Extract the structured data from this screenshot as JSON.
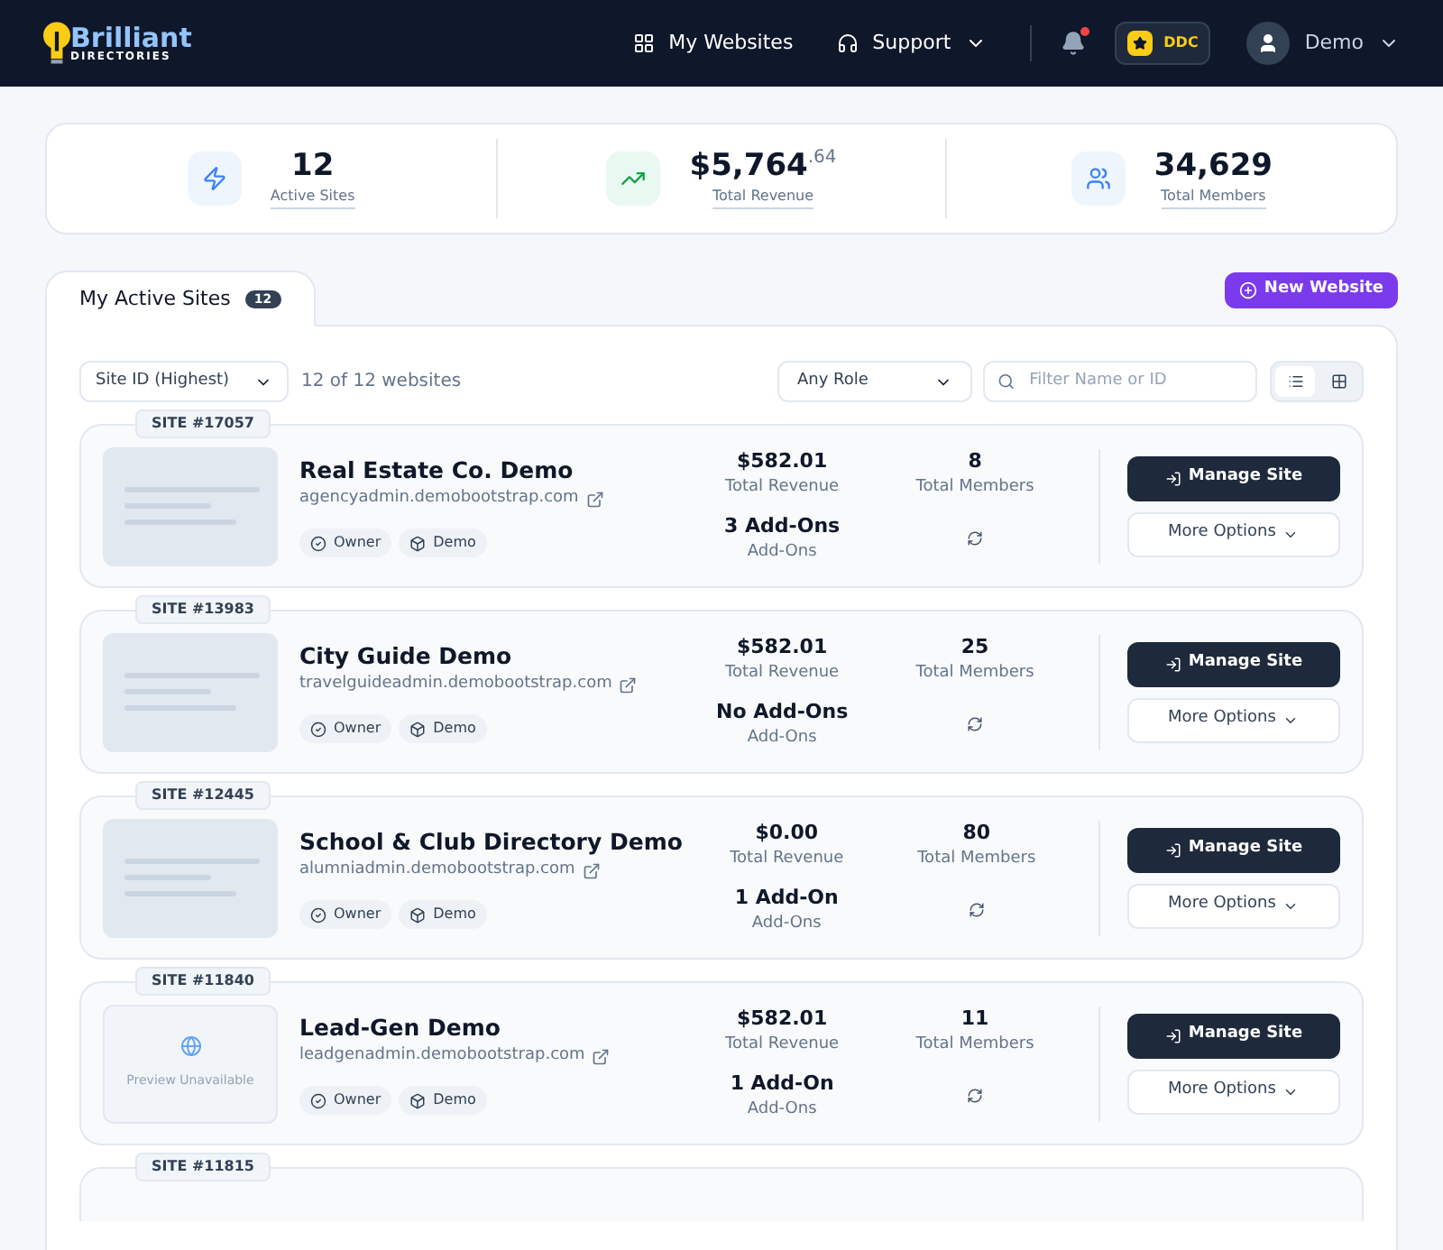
{
  "header": {
    "logo_top": "Brilliant",
    "logo_bottom": "DIRECTORIES",
    "nav": [
      {
        "label": "My Websites",
        "kind": "grid"
      },
      {
        "label": "Support",
        "kind": "support"
      }
    ],
    "notification_dot": true,
    "badge": "DDC",
    "user": "Demo"
  },
  "stats": [
    {
      "value": "12",
      "label": "Active Sites",
      "kind": "bolt"
    },
    {
      "value": "$5,764",
      "cents": ".64",
      "label": "Total Revenue",
      "kind": "chart"
    },
    {
      "value": "34,629",
      "label": "Total Members",
      "kind": "users"
    }
  ],
  "tab": {
    "label": "My Active Sites",
    "count": "12",
    "selected": true
  },
  "new_button": "New Website",
  "filters": {
    "sort": "Site ID (Highest)",
    "count_text": "12 of 12 websites",
    "role": "Any Role",
    "search_placeholder": "Filter Name or ID",
    "views": [
      {
        "kind": "list",
        "selected": true
      },
      {
        "kind": "grid",
        "selected": false
      }
    ]
  },
  "sites": [
    {
      "id": "SITE #17057",
      "name": "Real Estate Co. Demo",
      "domain": "agencyadmin.demobootstrap.com",
      "revenue": "$582.01",
      "revenue_label": "Total Revenue",
      "members": "8",
      "members_label": "Total Members",
      "addons": "3 Add-Ons",
      "addons_label": "Add-Ons",
      "preview": {
        "kind": "image"
      },
      "tags": [
        "Owner",
        "Demo"
      ],
      "manage": "Manage Site",
      "more": "More Options"
    },
    {
      "id": "SITE #13983",
      "name": "City Guide Demo",
      "domain": "travelguideadmin.demobootstrap.com",
      "revenue": "$582.01",
      "revenue_label": "Total Revenue",
      "members": "25",
      "members_label": "Total Members",
      "addons": "No Add-Ons",
      "addons_label": "Add-Ons",
      "preview": {
        "kind": "image"
      },
      "tags": [
        "Owner",
        "Demo"
      ],
      "manage": "Manage Site",
      "more": "More Options"
    },
    {
      "id": "SITE #12445",
      "name": "School & Club Directory Demo",
      "domain": "alumniadmin.demobootstrap.com",
      "revenue": "$0.00",
      "revenue_label": "Total Revenue",
      "members": "80",
      "members_label": "Total Members",
      "addons": "1 Add-On",
      "addons_label": "Add-Ons",
      "preview": {
        "kind": "image"
      },
      "tags": [
        "Owner",
        "Demo"
      ],
      "manage": "Manage Site",
      "more": "More Options"
    },
    {
      "id": "SITE #11840",
      "name": "Lead-Gen Demo",
      "domain": "leadgenadmin.demobootstrap.com",
      "revenue": "$582.01",
      "revenue_label": "Total Revenue",
      "members": "11",
      "members_label": "Total Members",
      "addons": "1 Add-On",
      "addons_label": "Add-Ons",
      "preview": {
        "kind": "unavailable",
        "text": "Preview Unavailable"
      },
      "tags": [
        "Owner",
        "Demo"
      ],
      "manage": "Manage Site",
      "more": "More Options"
    },
    {
      "id": "SITE #11815",
      "partial": true
    }
  ]
}
